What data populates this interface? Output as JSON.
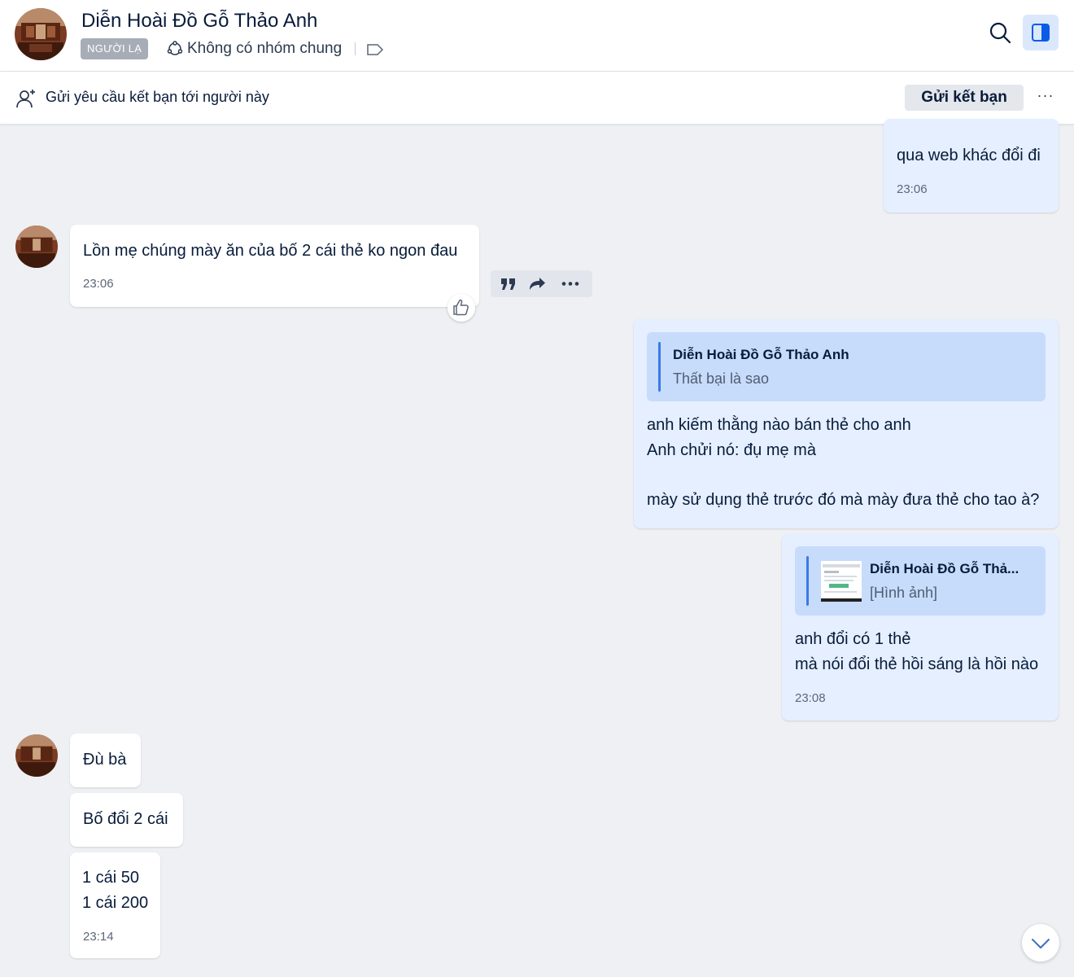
{
  "header": {
    "contact_name": "Diễn Hoài Đồ Gỗ Thảo Anh",
    "stranger_badge": "NGƯỜI LẠ",
    "common_groups": "Không có nhóm chung"
  },
  "friend_bar": {
    "text": "Gửi yêu cầu kết bạn tới người này",
    "send_button": "Gửi kết bạn",
    "more_label": "···"
  },
  "messages": [
    {
      "direction": "outgoing",
      "text": "qua web khác đổi đi",
      "time": "23:06"
    },
    {
      "direction": "incoming",
      "text": "Lồn mẹ chúng mày ăn của bố 2 cái thẻ ko ngon đau",
      "time": "23:06"
    },
    {
      "direction": "outgoing",
      "quote": {
        "name": "Diễn Hoài Đồ Gỗ Thảo Anh",
        "body": "Thất bại là sao"
      },
      "lines": [
        "anh kiếm thằng nào bán thẻ cho anh",
        "Anh chửi nó: đụ mẹ mà",
        "mày sử dụng thẻ trước đó mà mày đưa thẻ cho tao à?"
      ]
    },
    {
      "direction": "outgoing",
      "quote": {
        "name": "Diễn Hoài Đồ Gỗ Thả...",
        "body": "[Hình ảnh]"
      },
      "lines": [
        "anh đổi có 1 thẻ",
        "mà nói đổi thẻ hồi sáng là hồi nào"
      ],
      "time": "23:08"
    },
    {
      "direction": "incoming",
      "text": "Đù bà"
    },
    {
      "direction": "incoming",
      "text": "Bố đổi 2 cái"
    },
    {
      "direction": "incoming",
      "lines": [
        "1 cái 50",
        "1 cái 200"
      ],
      "time": "23:14"
    }
  ],
  "colors": {
    "background": "#eef0f3",
    "outgoing_bubble": "#e5efff",
    "incoming_bubble": "#ffffff",
    "quote_background": "#c7dcfb",
    "accent": "#3a7ae4",
    "stranger_badge": "#a7adb6"
  },
  "icons": [
    "search-icon",
    "panel-toggle-icon",
    "group-icon",
    "tag-icon",
    "add-friend-icon",
    "quote-icon",
    "forward-icon",
    "more-icon",
    "thumbs-up-icon",
    "chevron-down-icon"
  ]
}
